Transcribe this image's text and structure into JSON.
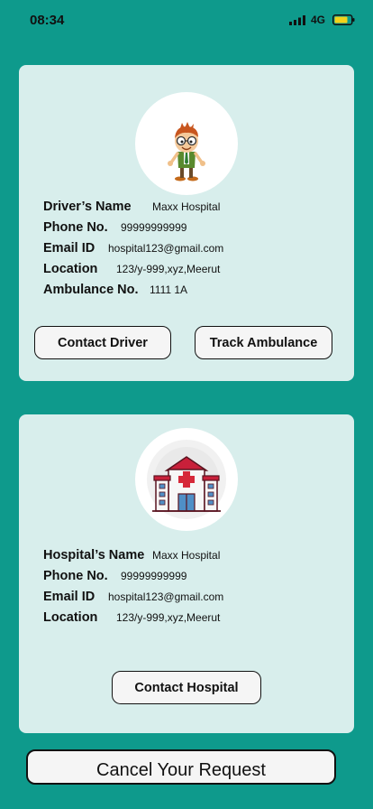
{
  "status_bar": {
    "time": "08:34",
    "network": "4G",
    "icons": [
      "signal-bars-icon",
      "battery-icon"
    ],
    "battery_color": "#F2D21B"
  },
  "colors": {
    "background": "#0E9A8C",
    "card": "#D8EEEC",
    "button": "#F5F5F5"
  },
  "driver_card": {
    "avatar_icon": "cartoon-driver-avatar",
    "fields": [
      {
        "label": "Driver’s Name",
        "value": "Maxx Hospital"
      },
      {
        "label": "Phone No.",
        "value": "99999999999"
      },
      {
        "label": "Email ID",
        "value": "hospital123@gmail.com"
      },
      {
        "label": "Location",
        "value": "123/y-999,xyz,Meerut"
      },
      {
        "label": "Ambulance No.",
        "value": "1111 1A"
      }
    ],
    "contact_button": "Contact Driver",
    "track_button": "Track Ambulance"
  },
  "hospital_card": {
    "avatar_icon": "hospital-building-icon",
    "fields": [
      {
        "label": "Hospital’s Name",
        "value": "Maxx Hospital"
      },
      {
        "label": "Phone No.",
        "value": "99999999999"
      },
      {
        "label": "Email ID",
        "value": "hospital123@gmail.com"
      },
      {
        "label": "Location",
        "value": "123/y-999,xyz,Meerut"
      }
    ],
    "contact_button": "Contact Hospital"
  },
  "cancel_button": "Cancel Your Request"
}
